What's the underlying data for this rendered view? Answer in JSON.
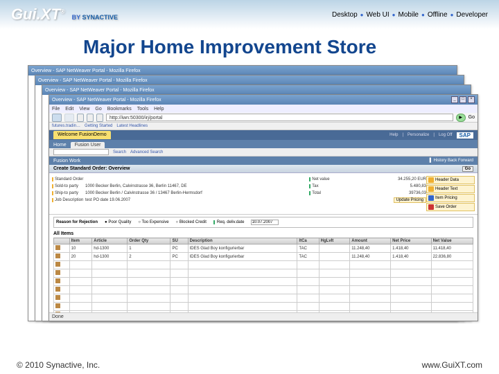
{
  "header": {
    "logo_main": "Gui.XT",
    "logo_reg": "®",
    "logo_by": "BY",
    "logo_syn": "SYNACTIVE",
    "nav": [
      "Desktop",
      "Web UI",
      "Mobile",
      "Offline",
      "Developer"
    ]
  },
  "title": "Major Home Improvement Store",
  "window": {
    "title": "Overview - SAP NetWeaver Portal - Mozilla Firefox",
    "menu": [
      "File",
      "Edit",
      "View",
      "Go",
      "Bookmarks",
      "Tools",
      "Help"
    ],
    "url": "http://iwn:50300/irj/portal",
    "go": "Go",
    "bookmarks": [
      "futures.tradin…",
      "Getting Started",
      "Latest Headlines"
    ]
  },
  "portal": {
    "welcome": "Welcome FusionDemo",
    "links": [
      "Help",
      "Personalize",
      "Log Off"
    ],
    "sap": "SAP",
    "tabs": [
      "Home",
      "Fusion User"
    ],
    "search": "Search",
    "adv": "Advanced Search",
    "panel": "Fusion Work",
    "history": "History",
    "back": "Back",
    "forward": "Forward"
  },
  "form": {
    "title": "Create Standard Order: Overview",
    "go": "Go",
    "left": [
      {
        "label": "Standard Order",
        "value": ""
      },
      {
        "label": "Sold-to party",
        "value": "1000    Becker Berlin, Calvinstrasse 36, Berlin 11467, DE"
      },
      {
        "label": "Ship-to party",
        "value": "1000    Becker Berlin / Calvinstrasse 36 / 13467 Berlin-Hermsdorf"
      },
      {
        "label": "Job Description",
        "value": "test                           PO date        19.06.2007"
      }
    ],
    "right": [
      {
        "label": "Net value",
        "value": "34.255,20        EUR"
      },
      {
        "label": "Tax",
        "value": "5.480,83"
      },
      {
        "label": "Total",
        "value": "39736,03"
      }
    ],
    "actions": [
      "Header Data",
      "Header Text",
      "Item Pricing",
      "Save Order"
    ],
    "update": "Update Pricing"
  },
  "reason": {
    "title": "Reason for Rejection",
    "options": [
      "Poor Quality",
      "Too Expensive",
      "Blocked Credit"
    ],
    "reqlabel": "Req. deliv.date",
    "reqdate": "10.07.2007"
  },
  "items": {
    "title": "All Items",
    "cols": [
      "",
      "Item",
      "Article",
      "Order Qty",
      "SU",
      "Description",
      "ItCa",
      "HgLvIt",
      "Amount",
      "Net Price",
      "Net Value"
    ],
    "rows": [
      [
        "",
        "10",
        "hd-1300",
        "1",
        "PC",
        "IDES Glad Boy konfigurierbar",
        "TAC",
        "",
        "11.248,40",
        "1.418,40",
        "11.418,40"
      ],
      [
        "",
        "20",
        "hd-1300",
        "2",
        "PC",
        "IDES Glad Boy konfigurierbar",
        "TAC",
        "",
        "11.248,40",
        "1.418,40",
        "22.836,80"
      ]
    ]
  },
  "statusbar": "Done",
  "footer": {
    "copyright": "© 2010 Synactive, Inc.",
    "url": "www.GuiXT.com"
  }
}
